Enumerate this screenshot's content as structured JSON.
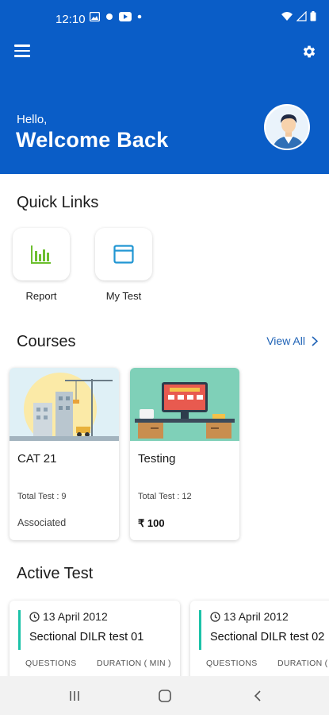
{
  "status_bar": {
    "time": "12:10"
  },
  "header": {
    "greeting_small": "Hello,",
    "greeting_big": "Welcome Back"
  },
  "quick_links": {
    "title": "Quick Links",
    "items": [
      {
        "label": "Report",
        "icon": "bar-chart-icon"
      },
      {
        "label": "My Test",
        "icon": "window-icon"
      }
    ]
  },
  "courses": {
    "title": "Courses",
    "view_all": "View All",
    "items": [
      {
        "name": "CAT 21",
        "total": "Total Test : 9",
        "footer": "Associated"
      },
      {
        "name": "Testing",
        "total": "Total Test : 12",
        "footer": "₹ 100"
      }
    ]
  },
  "active_test": {
    "title": "Active Test",
    "items": [
      {
        "date": "13 April 2012",
        "name": "Sectional DILR test 01",
        "questions_label": "QUESTIONS",
        "duration_label": "DURATION ( MIN )"
      },
      {
        "date": "13 April 2012",
        "name": "Sectional DILR test 02",
        "questions_label": "QUESTIONS",
        "duration_label": "DURATION ( MIN )"
      }
    ]
  },
  "colors": {
    "header_bg": "#0a5dc7",
    "accent": "#1e62b6",
    "test_accent": "#1bc2a8",
    "report_icon": "#6cbf2e",
    "test_icon": "#2196d3"
  }
}
